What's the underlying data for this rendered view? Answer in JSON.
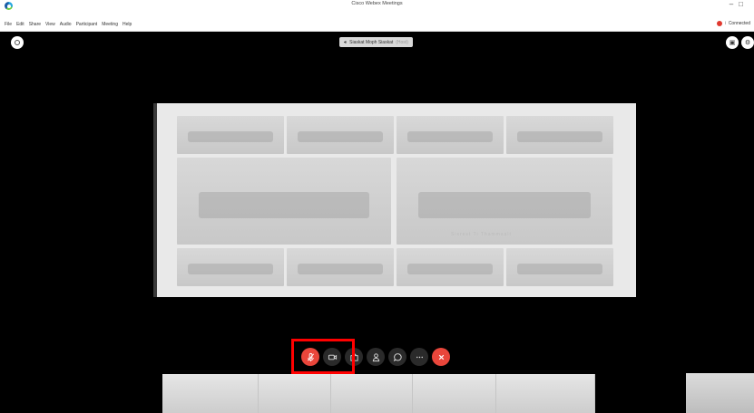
{
  "window": {
    "title": "Cisco Webex Meetings",
    "controls": [
      "–",
      "□"
    ]
  },
  "menu": {
    "items": [
      "File",
      "Edit",
      "Share",
      "View",
      "Audio",
      "Participant",
      "Meeting",
      "Help"
    ],
    "connection_status": "Connected"
  },
  "meeting": {
    "speaker_name": "Siaskat Moph Siaskat",
    "speaker_tag": "(Host)"
  },
  "shared_screen": {
    "tile_labels": [
      "",
      "",
      "",
      "",
      "",
      "",
      "Sisrest Ti Thammaalt",
      "",
      "",
      "",
      ""
    ]
  },
  "toolbar": {
    "buttons": [
      {
        "name": "mute-button",
        "icon": "microphone-icon",
        "state": "muted"
      },
      {
        "name": "video-button",
        "icon": "video-camera-icon"
      },
      {
        "name": "share-button",
        "icon": "share-icon"
      },
      {
        "name": "participants-button",
        "icon": "participants-icon"
      },
      {
        "name": "chat-button",
        "icon": "chat-icon"
      },
      {
        "name": "more-button",
        "icon": "more-icon"
      },
      {
        "name": "end-meeting-button",
        "icon": "close-icon"
      }
    ],
    "accent_color": "#e9463b",
    "highlight_color": "#ff0000"
  }
}
